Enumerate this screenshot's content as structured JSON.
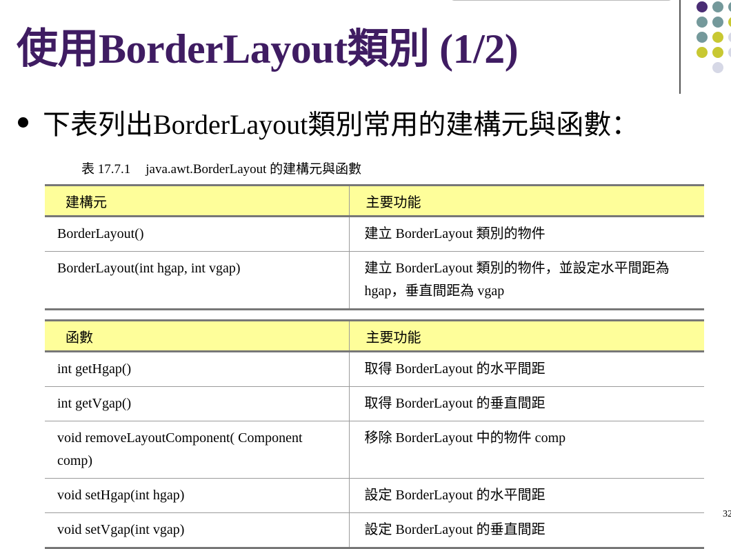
{
  "title": "使用BorderLayout類別 (1/2)",
  "bullet": "下表列出BorderLayout類別常用的建構元與函數：",
  "caption": {
    "number": "表 17.7.1",
    "text": "java.awt.BorderLayout 的建構元與函數"
  },
  "constructors": {
    "headers": [
      "建構元",
      "主要功能"
    ],
    "rows": [
      [
        "BorderLayout()",
        "建立 BorderLayout 類別的物件"
      ],
      [
        "BorderLayout(int hgap, int vgap)",
        "建立 BorderLayout 類別的物件，並設定水平間距為 hgap，垂直間距為 vgap"
      ]
    ]
  },
  "methods": {
    "headers": [
      "函數",
      "主要功能"
    ],
    "rows": [
      [
        "int getHgap()",
        "取得 BorderLayout 的水平間距"
      ],
      [
        "int getVgap()",
        "取得 BorderLayout 的垂直間距"
      ],
      [
        "void removeLayoutComponent( Component comp)",
        "移除 BorderLayout 中的物件 comp"
      ],
      [
        "void setHgap(int hgap)",
        "設定 BorderLayout 的水平間距"
      ],
      [
        "void setVgap(int vgap)",
        "設定 BorderLayout 的垂直間距"
      ]
    ]
  },
  "page_number": "32",
  "colors": {
    "title": "#3f1c62",
    "header_fill": "#fefe9a",
    "dot_purple": "#4a2d74",
    "dot_teal": "#74999b",
    "dot_olive": "#c8c832",
    "dot_lavender": "#d6d8e6"
  }
}
